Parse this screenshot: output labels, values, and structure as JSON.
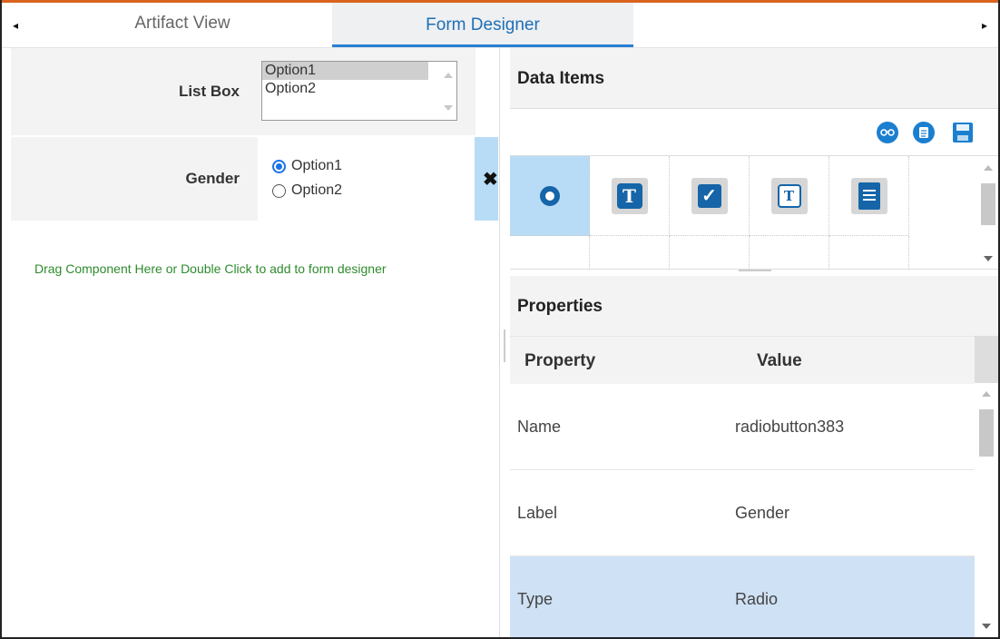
{
  "tabs": {
    "artifact_view": "Artifact View",
    "form_designer": "Form Designer",
    "left_arrow": "◂",
    "right_arrow": "▸"
  },
  "form": {
    "list_box": {
      "label": "List Box",
      "options": [
        "Option1",
        "Option2"
      ],
      "selected": "Option1"
    },
    "gender": {
      "label": "Gender",
      "options": [
        "Option1",
        "Option2"
      ],
      "selected": "Option1",
      "remove_glyph": "✖"
    },
    "drop_hint": "Drag Component Here or Double Click to add to form designer"
  },
  "data_items": {
    "title": "Data Items",
    "toolbar_icons": [
      "glasses-icon",
      "document-icon",
      "save-icon"
    ],
    "components": [
      {
        "icon": "radio-button-icon",
        "selected": true
      },
      {
        "icon": "text-box-icon",
        "glyph": "T"
      },
      {
        "icon": "checkbox-icon",
        "glyph": "✓"
      },
      {
        "icon": "text-area-icon",
        "glyph": "T"
      },
      {
        "icon": "list-doc-icon"
      }
    ]
  },
  "properties": {
    "title": "Properties",
    "col_property": "Property",
    "col_value": "Value",
    "rows": [
      {
        "property": "Name",
        "value": "radiobutton383"
      },
      {
        "property": "Label",
        "value": "Gender"
      },
      {
        "property": "Type",
        "value": "Radio",
        "selected": true
      }
    ]
  },
  "colors": {
    "accent": "#1f6fb5",
    "selection": "#b9dcf6",
    "hint_text": "#2e8b2e",
    "top_border": "#d9641e"
  }
}
